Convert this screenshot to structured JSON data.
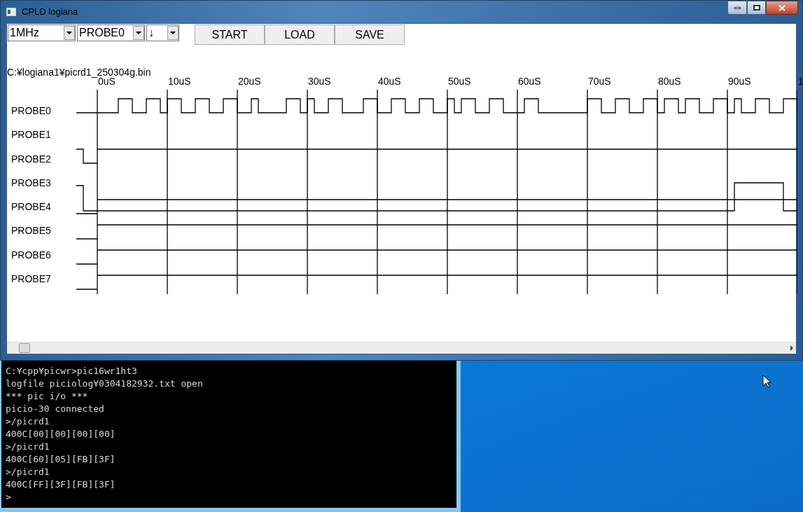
{
  "window": {
    "title": "CPLD logiana"
  },
  "toolbar": {
    "dropdowns": [
      {
        "value": "1MHz"
      },
      {
        "value": "PROBE0"
      },
      {
        "value": "↓"
      }
    ],
    "buttons": [
      "START",
      "LOAD",
      "SAVE"
    ]
  },
  "file_path": "C:¥logiana1¥picrd1_250304g.bin",
  "time_labels": [
    "0uS",
    "10uS",
    "20uS",
    "30uS",
    "40uS",
    "50uS",
    "60uS",
    "70uS",
    "80uS",
    "90uS",
    "1"
  ],
  "probes": [
    "PROBE0",
    "PROBE1",
    "PROBE2",
    "PROBE3",
    "PROBE4",
    "PROBE5",
    "PROBE6",
    "PROBE7"
  ],
  "console": {
    "lines": [
      "C:¥cpp¥picwr>pic16wr1ht3",
      "logfile piciolog¥0304182932.txt open",
      "*** pic i/o ***",
      "picio-30 connected",
      ">/picrd1",
      "400C[00][00][00][00]",
      ">/picrd1",
      "400C[60][05][FB][3F]",
      ">/picrd1",
      "400C[FF][3F][FB][3F]",
      ">"
    ]
  }
}
